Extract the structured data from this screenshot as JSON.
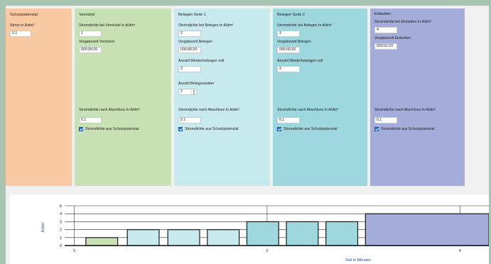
{
  "colors": {
    "outer_bg": "#a9c5b4",
    "panel_schutz": "#f9c9a4",
    "panel_vernickel": "#c9e2b5",
    "panel_belegen1": "#c8e9ee",
    "panel_belegen2": "#9ed7dd",
    "panel_einbetten": "#a4add9",
    "accent_checkbox": "#2f6fd1"
  },
  "panels": {
    "schutzpotenzial": {
      "title": "Schutzpotenzial",
      "strom_label": "Strom in A/dm²",
      "strom_value": "0.1"
    },
    "vernickel": {
      "title": "Vernickel",
      "stromdichte_label": "Stromdichte bei Vernickel In A/dm²",
      "stromdichte_value": "1",
      "vorgabezeit_label": "Vorgabezeit Vernickel",
      "vorgabezeit_value": "000:00:20",
      "abschluss_label": "Stromdichte nach Abschluss In A/dm²",
      "abschluss_value": "0.1",
      "checkbox_label": "Stromdichte aus Schutzpotenzial"
    },
    "belegen1": {
      "title": "Belegen Seite 1",
      "stromdichte_label": "Stromdichte bei Belegen In A/dm²",
      "stromdichte_value": "2",
      "vorgabezeit_label": "Vorgabezeit Belegen",
      "vorgabezeit_value": "000:00:20",
      "wiederholungen_label": "Anzahl Wiederholungen soll",
      "wiederholungen_value": "3",
      "belegenseiten_label": "Anzahl Belegenseiten",
      "belegenseiten_value": "2",
      "abschluss_label": "Stromdichte nach Abschluss In A/dm²",
      "abschluss_value": "0.1",
      "checkbox_label": "Stromdichte aus Schutzpotenzial"
    },
    "belegen2": {
      "title": "Belegen Seite 2",
      "stromdichte_label": "Stromdichte bei Belegen In A/dm²",
      "stromdichte_value": "3",
      "vorgabezeit_label": "Vorgabezeit Belegen",
      "vorgabezeit_value": "000:00:20",
      "wiederholungen_label": "Anzahl Wiederholungen soll",
      "wiederholungen_value": "3",
      "abschluss_label": "Stromdichte nach Abschluss In A/dm²",
      "abschluss_value": "0.1",
      "checkbox_label": "Stromdichte aus Schutzpotenzial"
    },
    "einbetten": {
      "title": "Einbetten",
      "stromdichte_label": "Stromdichte bei Einbetten In A/dm²",
      "stromdichte_value": "4",
      "vorgabezeit_label": "Vorgabezeit Einbetten",
      "vorgabezeit_value": "000:02:20",
      "abschluss_label": "Stromdichte nach Abschluss In A/dm²",
      "abschluss_value": "0.1",
      "checkbox_label": "Stromdichte aus Schutzpotenzial"
    }
  },
  "chart_data": {
    "type": "bar",
    "xlabel": "Zeit in Minuten",
    "ylabel": "A/dm²",
    "xlim": [
      -0.1,
      4.3
    ],
    "ylim": [
      0,
      5
    ],
    "yticks": [
      0,
      1,
      2,
      3,
      4,
      5
    ],
    "xticks": [
      0,
      2,
      4
    ],
    "grid": true,
    "series": [
      {
        "color": "#c9e2b5",
        "segments": [
          {
            "x0": 0.12,
            "x1": 0.45,
            "y": 1
          }
        ]
      },
      {
        "color": "#c8e9ee",
        "segments": [
          {
            "x0": 0.55,
            "x1": 0.88,
            "y": 2
          },
          {
            "x0": 0.97,
            "x1": 1.3,
            "y": 2
          },
          {
            "x0": 1.38,
            "x1": 1.71,
            "y": 2
          }
        ]
      },
      {
        "color": "#9ed7dd",
        "segments": [
          {
            "x0": 1.79,
            "x1": 2.12,
            "y": 3
          },
          {
            "x0": 2.2,
            "x1": 2.53,
            "y": 3
          },
          {
            "x0": 2.61,
            "x1": 2.94,
            "y": 3
          }
        ]
      },
      {
        "color": "#a4add9",
        "segments": [
          {
            "x0": 3.02,
            "x1": 4.3,
            "y": 4
          }
        ]
      }
    ]
  }
}
